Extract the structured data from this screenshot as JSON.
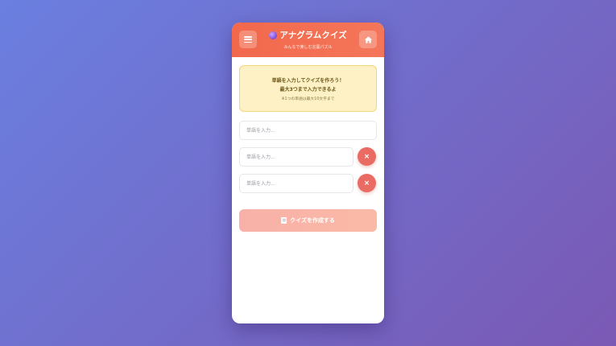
{
  "header": {
    "title": "アナグラムクイズ",
    "subtitle": "みんなで楽しむ言葉パズル",
    "menu_icon": "hamburger-menu-icon",
    "home_icon": "home-icon",
    "title_icon": "globe-icon"
  },
  "notice": {
    "line1": "単語を入力してクイズを作ろう！",
    "line2": "最大3つまで入力できるよ",
    "line3": "※1つの単語は最大10文字まで"
  },
  "inputs": [
    {
      "placeholder": "単語を入力...",
      "value": ""
    },
    {
      "placeholder": "単語を入力...",
      "value": ""
    },
    {
      "placeholder": "単語を入力...",
      "value": ""
    }
  ],
  "delete_button_label": "×",
  "create_button": {
    "label": "クイズを作成する",
    "icon": "document-icon"
  },
  "colors": {
    "header": "#f2684c",
    "notice_bg": "#fdf1c5",
    "delete_button": "#e96b63",
    "create_button": "#f8b1a8",
    "background_start": "#6a7fe0",
    "background_end": "#7a59b4"
  }
}
